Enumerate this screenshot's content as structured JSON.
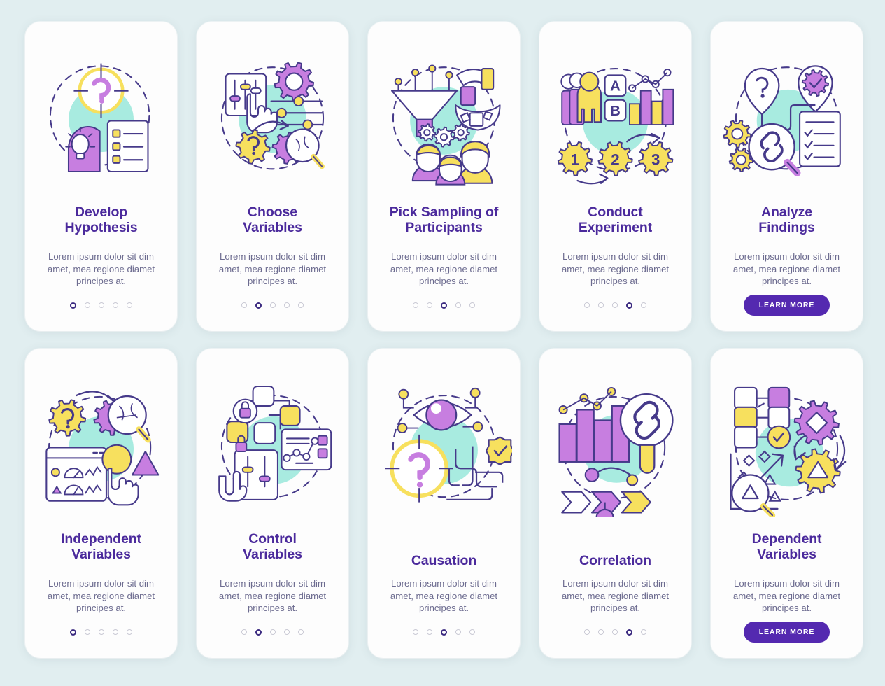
{
  "page": {
    "background_color": "#e1eef0",
    "card_background": "#fdfdfd",
    "title_color": "#4b2a9c",
    "desc_color": "#6c6b8f",
    "accent_purple": "#5429b0",
    "accent_violet": "#c77ee0",
    "accent_yellow": "#f7e05e",
    "accent_mint": "#a8ebe0",
    "stroke_color": "#463a8a"
  },
  "learn_more_label": "LEARN MORE",
  "body_text": "Lorem ipsum dolor sit dim amet, mea regione diamet principes at.",
  "cards": [
    {
      "title": "Develop Hypothesis",
      "title_lines": [
        "Develop",
        "Hypothesis"
      ],
      "desc": "Lorem ipsum dolor sit dim amet, mea regione diamet principes at.",
      "dots": 5,
      "active_dot": 1,
      "has_button": false,
      "illustration": "target-question-head-lightbulb-checklist"
    },
    {
      "title": "Choose Variables",
      "title_lines": [
        "Choose",
        "Variables"
      ],
      "desc": "Lorem ipsum dolor sit dim amet, mea regione diamet principes at.",
      "dots": 5,
      "active_dot": 2,
      "has_button": false,
      "illustration": "sliders-gear-hand-magnifier"
    },
    {
      "title": "Pick Sampling of Participants",
      "title_lines": [
        "Pick Sampling of",
        "Participants"
      ],
      "desc": "Lorem ipsum dolor sit dim amet, mea regione diamet principes at.",
      "dots": 5,
      "active_dot": 3,
      "has_button": false,
      "illustration": "funnel-hand-people-gears"
    },
    {
      "title": "Conduct Experiment",
      "title_lines": [
        "Conduct",
        "Experiment"
      ],
      "desc": "Lorem ipsum dolor sit dim amet, mea regione diamet principes at.",
      "dots": 5,
      "active_dot": 4,
      "has_button": false,
      "illustration": "people-ab-test-barchart-gears-123"
    },
    {
      "title": "Analyze Findings",
      "title_lines": [
        "Analyze",
        "Findings"
      ],
      "desc": "Lorem ipsum dolor sit dim amet, mea regione diamet principes at.",
      "dots": 0,
      "active_dot": 0,
      "has_button": true,
      "illustration": "pins-gears-magnifier-link-checklist"
    },
    {
      "title": "Independent Variables",
      "title_lines": [
        "Independent",
        "Variables"
      ],
      "desc": "Lorem ipsum dolor sit dim amet, mea regione diamet principes at.",
      "dots": 5,
      "active_dot": 1,
      "has_button": false,
      "illustration": "gears-magnifier-dashboard-hand"
    },
    {
      "title": "Control Variables",
      "title_lines": [
        "Control",
        "Variables"
      ],
      "desc": "Lorem ipsum dolor sit dim amet, mea regione diamet principes at.",
      "dots": 5,
      "active_dot": 2,
      "has_button": false,
      "illustration": "nodes-lock-sliders-chart"
    },
    {
      "title": "Causation",
      "title_lines": [
        "Causation"
      ],
      "desc": "Lorem ipsum dolor sit dim amet, mea regione diamet principes at.",
      "dots": 5,
      "active_dot": 3,
      "has_button": false,
      "illustration": "eye-target-question-maze-badge"
    },
    {
      "title": "Correlation",
      "title_lines": [
        "Correlation"
      ],
      "desc": "Lorem ipsum dolor sit dim amet, mea regione diamet principes at.",
      "dots": 5,
      "active_dot": 4,
      "has_button": false,
      "illustration": "barchart-magnifier-link-arrows"
    },
    {
      "title": "Dependent Variables",
      "title_lines": [
        "Dependent",
        "Variables"
      ],
      "desc": "Lorem ipsum dolor sit dim amet, mea regione diamet principes at.",
      "dots": 0,
      "active_dot": 0,
      "has_button": true,
      "illustration": "flowchart-gears-magnifier-shapes"
    }
  ]
}
